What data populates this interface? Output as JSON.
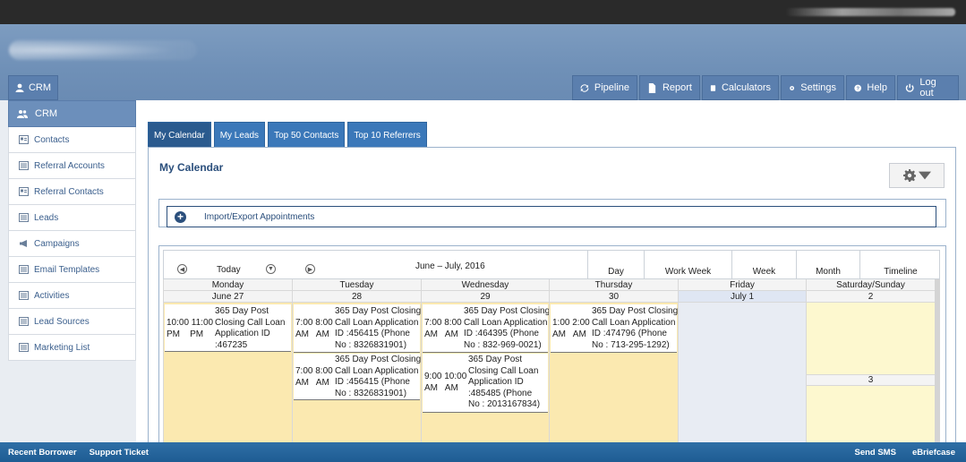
{
  "crm_tab": {
    "label": "CRM"
  },
  "topnav": [
    {
      "label": "Pipeline",
      "icon": "refresh-icon"
    },
    {
      "label": "Report",
      "icon": "document-icon"
    },
    {
      "label": "Calculators",
      "icon": "calculator-icon"
    },
    {
      "label": "Settings",
      "icon": "gear-icon"
    },
    {
      "label": "Help",
      "icon": "help-icon"
    },
    {
      "label": "Log out",
      "icon": "power-icon"
    }
  ],
  "sidebar": {
    "header": "CRM",
    "items": [
      {
        "label": "Contacts",
        "icon": "contact-card-icon"
      },
      {
        "label": "Referral Accounts",
        "icon": "list-icon"
      },
      {
        "label": "Referral Contacts",
        "icon": "contact-card-icon"
      },
      {
        "label": "Leads",
        "icon": "list-icon"
      },
      {
        "label": "Campaigns",
        "icon": "megaphone-icon"
      },
      {
        "label": "Email Templates",
        "icon": "list-icon"
      },
      {
        "label": "Activities",
        "icon": "list-icon"
      },
      {
        "label": "Lead Sources",
        "icon": "list-icon"
      },
      {
        "label": "Marketing List",
        "icon": "list-icon"
      }
    ]
  },
  "tabs": [
    {
      "label": "My Calendar",
      "active": true
    },
    {
      "label": "My Leads",
      "active": false
    },
    {
      "label": "Top 50 Contacts",
      "active": false
    },
    {
      "label": "Top 10 Referrers",
      "active": false
    }
  ],
  "panel": {
    "title": "My Calendar",
    "import_label": "Import/Export Appointments"
  },
  "calendar": {
    "today_label": "Today",
    "range": "June – July, 2016",
    "views": [
      "Day",
      "Work Week",
      "Week",
      "Month",
      "Timeline"
    ],
    "days": [
      {
        "name": "Monday",
        "date": "June 27"
      },
      {
        "name": "Tuesday",
        "date": "28"
      },
      {
        "name": "Wednesday",
        "date": "29"
      },
      {
        "name": "Thursday",
        "date": "30"
      },
      {
        "name": "Friday",
        "date": "July 1"
      },
      {
        "name": "Saturday/Sunday",
        "date": "2",
        "date2": "3"
      }
    ],
    "appointments": {
      "mon_1": {
        "times": "10:00 11:00\nPM    PM",
        "desc": "365 Day Post\nClosing Call Loan\nApplication ID\n:467235"
      },
      "tue_1": {
        "times": "7:00 8:00\nAM   AM",
        "desc": "365 Day Post Closing\nCall Loan Application\nID :456415 (Phone\nNo : 8326831901)"
      },
      "tue_2": {
        "times": "7:00 8:00\nAM   AM",
        "desc": "365 Day Post Closing\nCall Loan Application\nID :456415 (Phone\nNo : 8326831901)"
      },
      "wed_1": {
        "times": "7:00 8:00\nAM   AM",
        "desc": "365 Day Post Closing\nCall Loan Application\nID :464395 (Phone\nNo : 832-969-0021)"
      },
      "wed_2": {
        "times": "9:00 10:00\nAM   AM",
        "desc": "365 Day Post\nClosing Call Loan\nApplication ID\n:485485 (Phone\nNo : 2013167834)"
      },
      "thu_1": {
        "times": "1:00 2:00\nAM   AM",
        "desc": "365 Day Post Closing\nCall Loan Application\nID :474796 (Phone\nNo : 713-295-1292)"
      }
    }
  },
  "bottombar": {
    "left": [
      "Recent Borrower",
      "Support Ticket"
    ],
    "right": [
      "Send SMS",
      "eBriefcase"
    ]
  },
  "colors": {
    "header": "#7396bd",
    "nav_button": "#5b7fae",
    "tab": "#3b78b9",
    "appt_bg": "#fbe9b0",
    "friday_bg": "#e8ecf3",
    "weekend_bg": "#fdf8cf"
  }
}
